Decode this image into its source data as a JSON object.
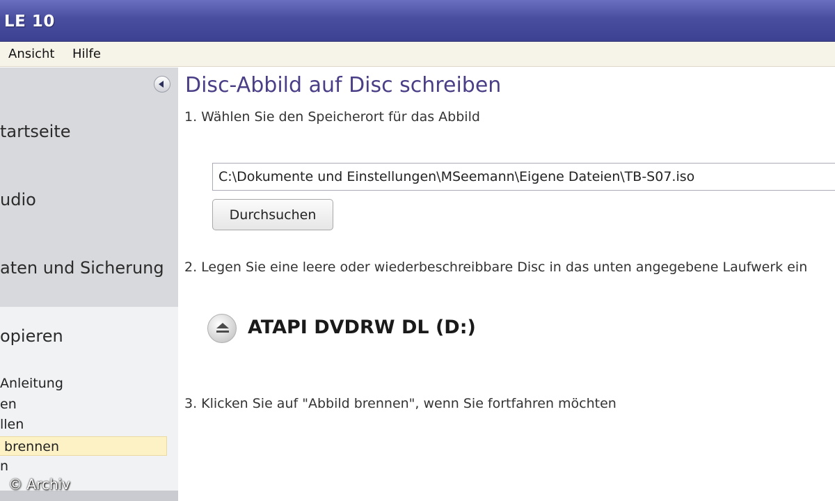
{
  "window": {
    "title": "LE 10"
  },
  "menu": {
    "items": [
      "Ansicht",
      "Hilfe"
    ]
  },
  "sidebar": {
    "categories": [
      "tartseite",
      "udio",
      "aten und Sicherung",
      "opieren"
    ],
    "sub_items": [
      "Anleitung",
      "en",
      "llen",
      " brennen",
      "n"
    ],
    "selected_index": 3
  },
  "main": {
    "title": "Disc-Abbild auf Disc schreiben",
    "step1": "1. Wählen Sie den Speicherort für das Abbild",
    "path_value": "C:\\Dokumente und Einstellungen\\MSeemann\\Eigene Dateien\\TB-S07.iso",
    "browse_label": "Durchsuchen",
    "step2": "2. Legen Sie eine leere oder wiederbeschreibbare Disc in das unten angegebene Laufwerk ein",
    "drive_name": "ATAPI DVDRW DL (D:)",
    "step3": "3. Klicken Sie auf \"Abbild brennen\", wenn Sie fortfahren möchten"
  },
  "watermark": "© Archiv",
  "colors": {
    "titlebar": "#4a4e9e",
    "heading": "#4a3f86",
    "sidebar_upper": "#d8d9dc",
    "selection": "#fdf2c6"
  }
}
